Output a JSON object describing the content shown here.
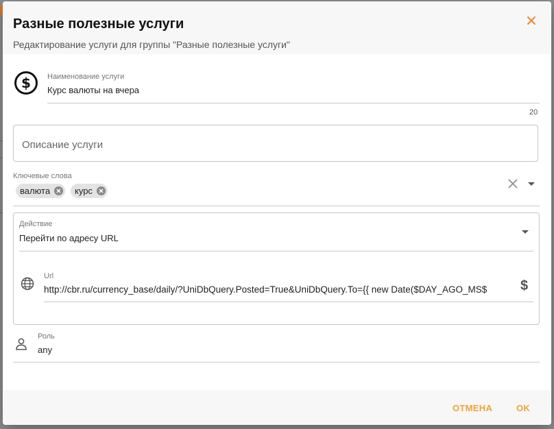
{
  "dialog": {
    "title": "Разные полезные услуги",
    "subtitle": "Редактирование услуги для группы \"Разные полезные услуги\""
  },
  "service_name": {
    "label": "Наименование услуги",
    "value": "Курс валюты на вчера",
    "counter": "20",
    "icon": "dollar-circle-icon"
  },
  "description": {
    "placeholder": "Описание услуги"
  },
  "keywords": {
    "label": "Ключевые слова",
    "chips": [
      "валюта",
      "курс"
    ]
  },
  "action": {
    "label": "Действие",
    "value": "Перейти по адресу URL",
    "url_label": "Url",
    "url_value": "http://cbr.ru/currency_base/daily/?UniDbQuery.Posted=True&UniDbQuery.To={{ new Date($DAY_AGO_MS$"
  },
  "role": {
    "label": "Роль",
    "value": "any"
  },
  "footer": {
    "cancel_label": "ОТМЕНА",
    "ok_label": "OK"
  },
  "colors": {
    "accent": "#f0a23a",
    "close": "#e8892c"
  }
}
